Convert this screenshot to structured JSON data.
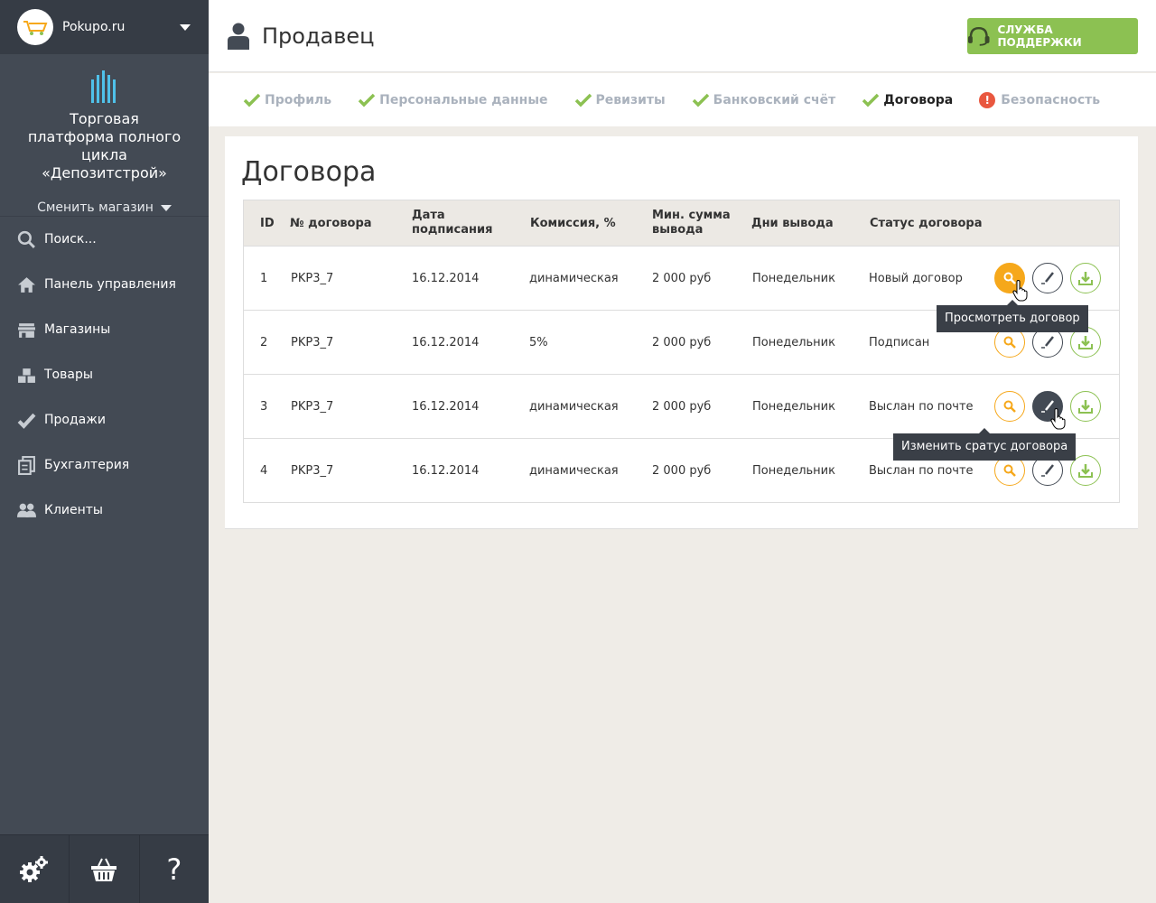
{
  "store": {
    "name": "Pokupo.ru"
  },
  "brand": {
    "title_lines": [
      "Торговая",
      "платформа полного цикла",
      "«Депозитстрой»"
    ],
    "switch_label": "Сменить магазин"
  },
  "nav": [
    {
      "label": "Поиск...",
      "icon": "search-icon"
    },
    {
      "label": "Панель управления",
      "icon": "home-icon"
    },
    {
      "label": "Магазины",
      "icon": "store-icon"
    },
    {
      "label": "Товары",
      "icon": "boxes-icon"
    },
    {
      "label": "Продажи",
      "icon": "check-icon"
    },
    {
      "label": "Бухгалтерия",
      "icon": "documents-icon"
    },
    {
      "label": "Клиенты",
      "icon": "users-icon"
    }
  ],
  "bottom": {
    "help_label": "?"
  },
  "header": {
    "title": "Продавец",
    "support_label": "СЛУЖБА ПОДДЕРЖКИ"
  },
  "tabs": [
    {
      "label": "Профиль",
      "state": "done"
    },
    {
      "label": "Персональные данные",
      "state": "done"
    },
    {
      "label": "Ревизиты",
      "state": "done"
    },
    {
      "label": "Банковский счёт",
      "state": "done"
    },
    {
      "label": "Договора",
      "state": "active"
    },
    {
      "label": "Безопасность",
      "state": "alert"
    }
  ],
  "alert_mark": "!",
  "content": {
    "title": "Договора",
    "columns": {
      "id": "ID",
      "number": "№ договора",
      "date_l1": "Дата",
      "date_l2": "подписания",
      "commission": "Комиссия, %",
      "min_l1": "Мин. сумма",
      "min_l2": "вывода",
      "days": "Дни вывода",
      "status": "Статус договора"
    },
    "rows": [
      {
        "id": "1",
        "number": "PKP3_7",
        "date": "16.12.2014",
        "commission": "динамическая",
        "min": "2 000 руб",
        "days": "Понедельник",
        "status": "Новый договор"
      },
      {
        "id": "2",
        "number": "PKP3_7",
        "date": "16.12.2014",
        "commission": "5%",
        "min": "2 000 руб",
        "days": "Понедельник",
        "status": "Подписан"
      },
      {
        "id": "3",
        "number": "PKP3_7",
        "date": "16.12.2014",
        "commission": "динамическая",
        "min": "2 000 руб",
        "days": "Понедельник",
        "status": "Выслан по почте"
      },
      {
        "id": "4",
        "number": "PKP3_7",
        "date": "16.12.2014",
        "commission": "динамическая",
        "min": "2 000 руб",
        "days": "Понедельник",
        "status": "Выслан по почте"
      }
    ]
  },
  "tooltips": {
    "view": "Просмотреть договор",
    "edit": "Изменить сратус договора"
  },
  "colors": {
    "sidebar": "#434a54",
    "green": "#8cc152",
    "orange": "#f6a81b",
    "dark": "#434a54",
    "red": "#e9573f"
  }
}
